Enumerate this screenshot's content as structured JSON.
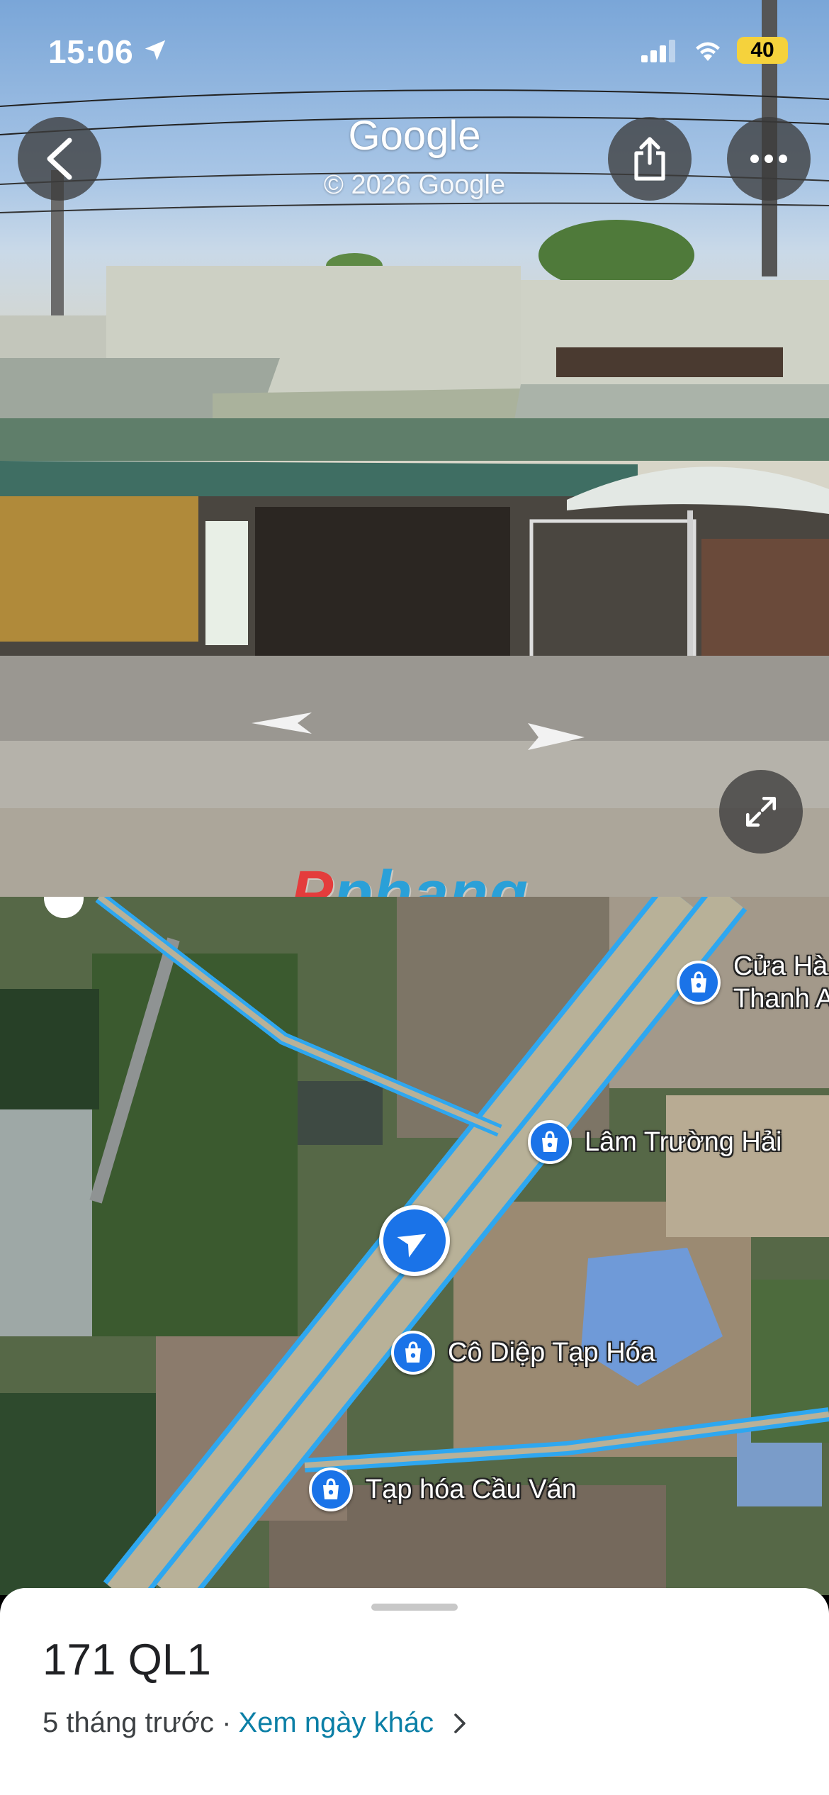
{
  "status_bar": {
    "time": "15:06",
    "battery": "40"
  },
  "header": {
    "title": "Google",
    "copyright": "© 2026 Google"
  },
  "watermark": {
    "text_first": "P",
    "text_rest": "phang"
  },
  "map": {
    "pois": [
      {
        "label": "Cửa Hà\nThanh A"
      },
      {
        "label": "Lâm Trường Hải"
      },
      {
        "label": "Cô Diệp Tạp Hóa"
      },
      {
        "label": "Tạp hóa Cầu Ván"
      }
    ]
  },
  "sheet": {
    "address": "171 QL1",
    "age": "5 tháng trước ·",
    "other_dates_link": "Xem ngày khác"
  },
  "colors": {
    "map_blue": "#1a73e8",
    "road_highlight": "#2ea7f0",
    "link": "#0b7fa6"
  },
  "icons": [
    "location-arrow-icon",
    "signal-icon",
    "wifi-icon",
    "back-icon",
    "share-icon",
    "more-icon",
    "expand-icon",
    "shopping-bag-icon",
    "navigation-arrow-icon",
    "chevron-right-icon"
  ]
}
